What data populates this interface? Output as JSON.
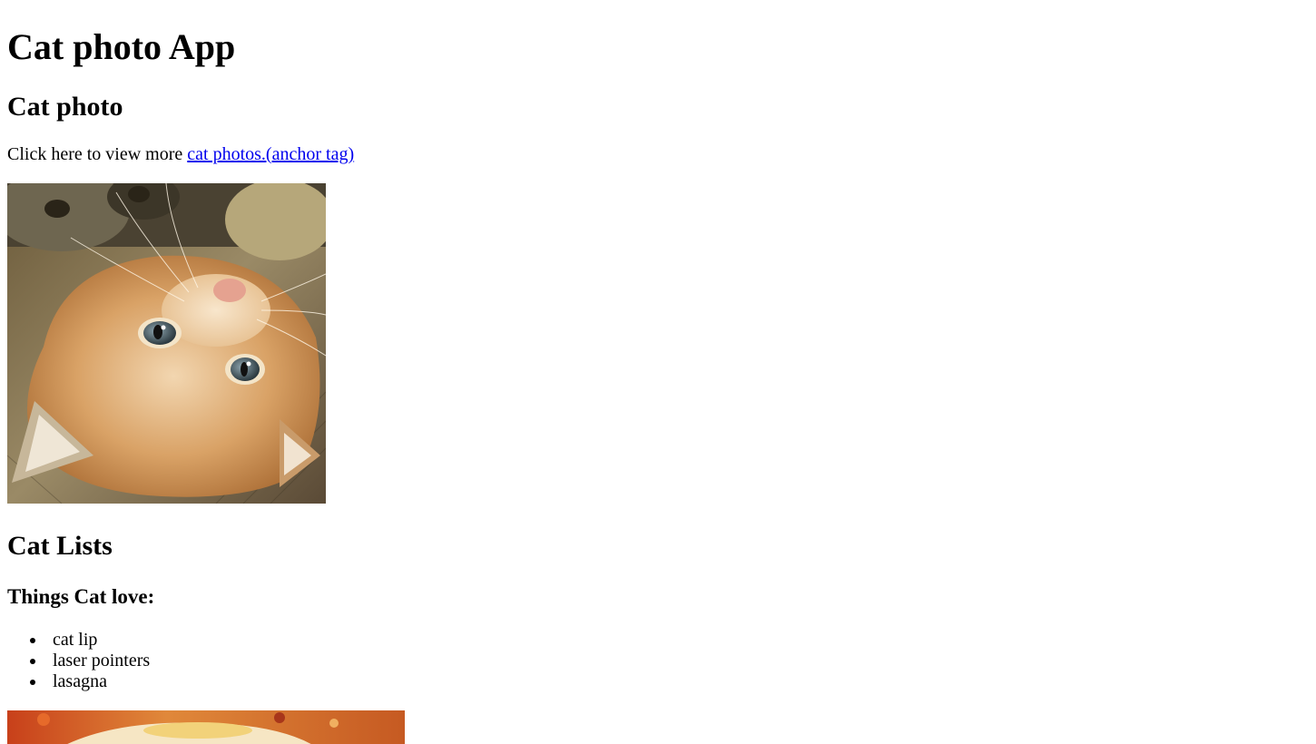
{
  "header": {
    "title": "Cat photo App"
  },
  "cat_photo_section": {
    "heading": "Cat photo",
    "intro_text": "Click here to view more ",
    "link_text": "cat photos.(anchor tag)",
    "image_alt": "A cute orange cat lying on its back."
  },
  "cat_lists_section": {
    "heading": "Cat Lists",
    "subheading": "Things Cat love:",
    "items": [
      {
        "label": "cat lip"
      },
      {
        "label": "laser pointers"
      },
      {
        "label": "lasagna"
      }
    ],
    "lasagna_image_alt": "A slice of lasagna on a plate."
  }
}
